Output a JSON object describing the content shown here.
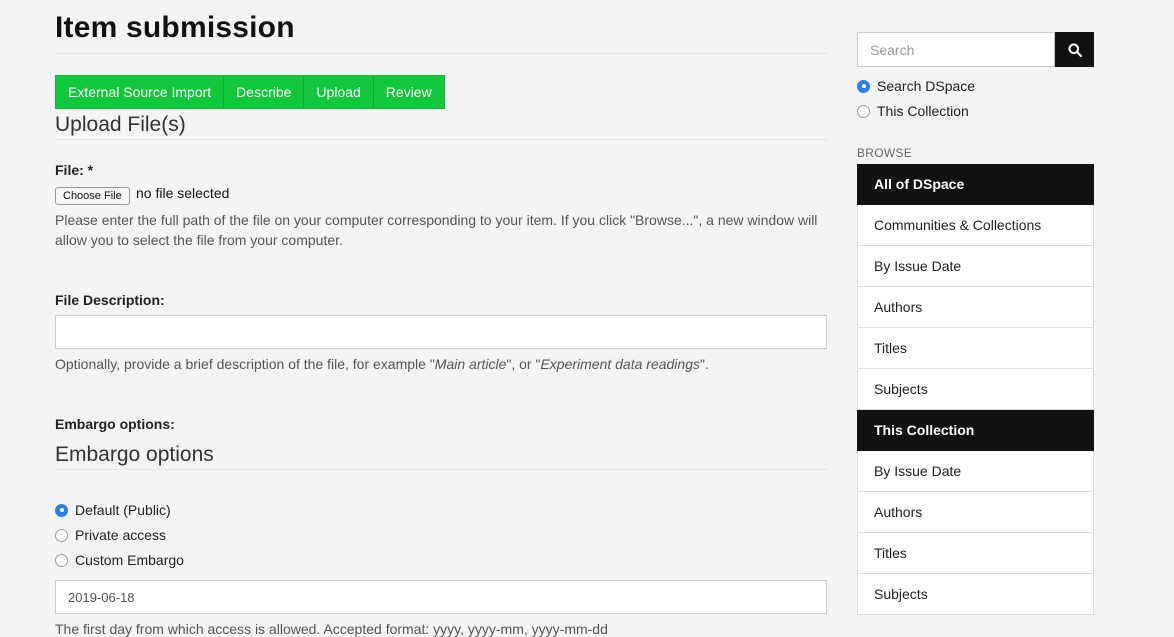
{
  "page": {
    "title": "Item submission"
  },
  "steps": [
    {
      "label": "External Source Import"
    },
    {
      "label": "Describe"
    },
    {
      "label": "Upload"
    },
    {
      "label": "Review"
    }
  ],
  "upload": {
    "heading": "Upload File(s)",
    "file_label": "File: *",
    "choose_button": "Choose File",
    "no_file_text": "no file selected",
    "file_help": "Please enter the full path of the file on your computer corresponding to your item. If you click \"Browse...\", a new window will allow you to select the file from your computer.",
    "description_label": "File Description:",
    "description_value": "",
    "description_help_prefix": "Optionally, provide a brief description of the file, for example \"",
    "description_help_example1": "Main article",
    "description_help_middle": "\", or \"",
    "description_help_example2": "Experiment data readings",
    "description_help_suffix": "\"."
  },
  "embargo": {
    "label": "Embargo options:",
    "heading": "Embargo options",
    "options": [
      {
        "label": "Default (Public)",
        "checked": true
      },
      {
        "label": "Private access",
        "checked": false
      },
      {
        "label": "Custom Embargo",
        "checked": false
      }
    ],
    "date_value": "2019-06-18",
    "date_help": "The first day from which access is allowed. Accepted format: yyyy, yyyy-mm, yyyy-mm-dd"
  },
  "sidebar": {
    "search_placeholder": "Search",
    "search_icon": "magnifier-icon",
    "scope_options": [
      {
        "label": "Search DSpace",
        "checked": true
      },
      {
        "label": "This Collection",
        "checked": false
      }
    ],
    "browse_label": "BROWSE",
    "browse_all": {
      "header": "All of DSpace",
      "items": [
        "Communities & Collections",
        "By Issue Date",
        "Authors",
        "Titles",
        "Subjects"
      ]
    },
    "browse_collection": {
      "header": "This Collection",
      "items": [
        "By Issue Date",
        "Authors",
        "Titles",
        "Subjects"
      ]
    }
  },
  "colors": {
    "step_green": "#11c83c",
    "radio_blue": "#2b7fe6",
    "sidebar_header": "#111111"
  }
}
